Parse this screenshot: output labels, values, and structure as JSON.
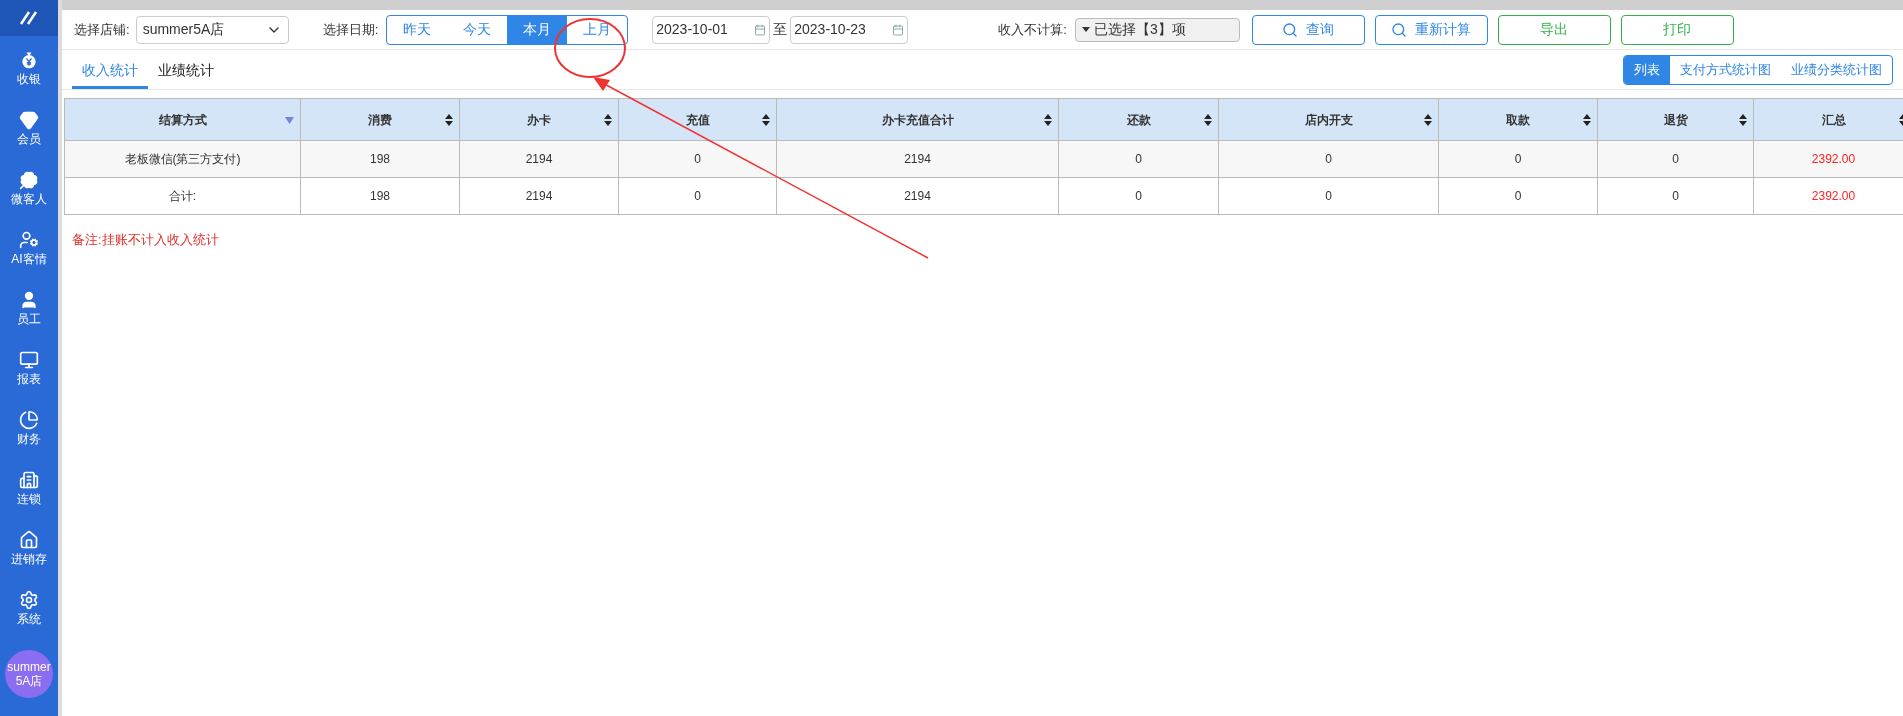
{
  "sidebar": {
    "items": [
      {
        "label": "收银"
      },
      {
        "label": "会员"
      },
      {
        "label": "微客人"
      },
      {
        "label": "AI客情"
      },
      {
        "label": "员工"
      },
      {
        "label": "报表"
      },
      {
        "label": "财务"
      },
      {
        "label": "连锁"
      },
      {
        "label": "进销存"
      },
      {
        "label": "系统"
      }
    ],
    "avatar": "summer5A店"
  },
  "filters": {
    "store_label": "选择店铺:",
    "store_value": "summer5A店",
    "date_label": "选择日期:",
    "date_ranges": [
      {
        "label": "昨天",
        "selected": false
      },
      {
        "label": "今天",
        "selected": false
      },
      {
        "label": "本月",
        "selected": true
      },
      {
        "label": "上月",
        "selected": false
      }
    ],
    "start_date": "2023-10-01",
    "date_separator": "至",
    "end_date": "2023-10-23",
    "exclude_label": "收入不计算:",
    "exclude_value": "已选择【3】项",
    "buttons": [
      {
        "label": "查询",
        "kind": "search"
      },
      {
        "label": "重新计算",
        "kind": "search"
      },
      {
        "label": "导出",
        "kind": "plain"
      },
      {
        "label": "打印",
        "kind": "plain"
      }
    ]
  },
  "tabs": [
    {
      "label": "收入统计",
      "selected": true
    },
    {
      "label": "业绩统计",
      "selected": false
    }
  ],
  "views": [
    {
      "label": "列表",
      "selected": true
    },
    {
      "label": "支付方式统计图",
      "selected": false
    },
    {
      "label": "业绩分类统计图",
      "selected": false
    }
  ],
  "table": {
    "columns": [
      {
        "label": "结算方式",
        "kind": "filter",
        "emphasis": false
      },
      {
        "label": "消费",
        "kind": "sort",
        "emphasis": false
      },
      {
        "label": "办卡",
        "kind": "sort",
        "emphasis": false
      },
      {
        "label": "充值",
        "kind": "sort",
        "emphasis": false
      },
      {
        "label": "办卡充值合计",
        "kind": "sort",
        "emphasis": false
      },
      {
        "label": "还款",
        "kind": "sort",
        "emphasis": false
      },
      {
        "label": "店内开支",
        "kind": "sort",
        "emphasis": false
      },
      {
        "label": "取款",
        "kind": "sort",
        "emphasis": false
      },
      {
        "label": "退货",
        "kind": "sort",
        "emphasis": false
      },
      {
        "label": "汇总",
        "kind": "sort",
        "emphasis": true
      }
    ],
    "rows": [
      [
        "老板微信(第三方支付)",
        "198",
        "2194",
        "0",
        "2194",
        "0",
        "0",
        "0",
        "0",
        "2392.00"
      ],
      [
        "合计:",
        "198",
        "2194",
        "0",
        "2194",
        "0",
        "0",
        "0",
        "0",
        "2392.00"
      ]
    ]
  },
  "note": "备注:挂账不计入收入统计"
}
